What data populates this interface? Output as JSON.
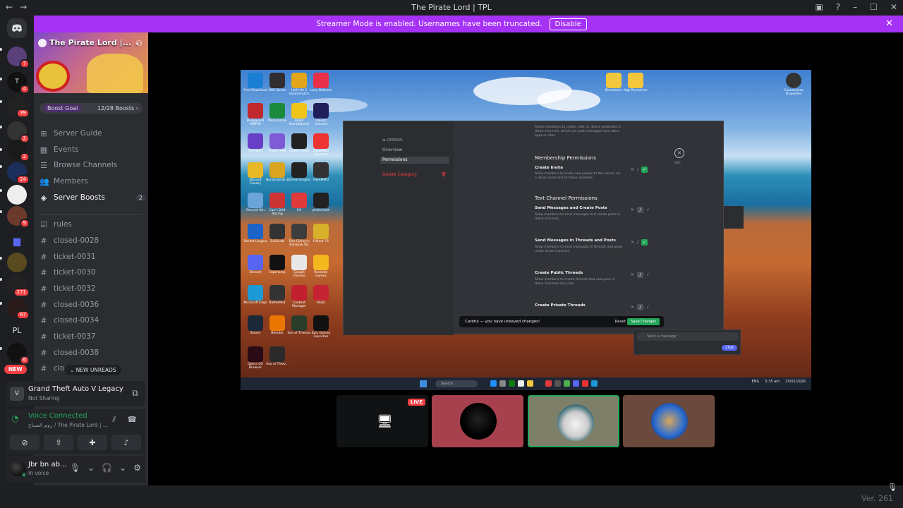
{
  "window": {
    "title": "The Pirate Lord | TPL",
    "back_glyph": "←",
    "forward_glyph": "→",
    "controls": [
      "▣",
      "?",
      "–",
      "☐",
      "✕"
    ]
  },
  "streamer_banner": {
    "text": "Streamer Mode is enabled. Usernames have been truncated.",
    "button": "Disable",
    "close": "✕"
  },
  "guild_rail": {
    "items": [
      {
        "label": "",
        "badge": "7"
      },
      {
        "label": "T",
        "badge": "4"
      },
      {
        "label": "",
        "badge": "39"
      },
      {
        "label": "",
        "badge": "2"
      },
      {
        "label": "",
        "badge": "2"
      },
      {
        "label": "",
        "badge": "24"
      },
      {
        "label": "",
        "badge": ""
      },
      {
        "label": "",
        "badge": "9"
      },
      {
        "label": "",
        "badge": ""
      },
      {
        "label": "",
        "badge": ""
      },
      {
        "label": "",
        "badge": "271"
      },
      {
        "label": "",
        "badge": "67"
      },
      {
        "label": "PL",
        "badge": ""
      },
      {
        "label": "",
        "badge": "6"
      }
    ],
    "new_badge": "NEW"
  },
  "server": {
    "name": "The Pirate Lord |...",
    "boost_goal": "Boost Goal",
    "boost_count": "12/28 Boosts",
    "boost_chevron": "›",
    "nav": [
      {
        "label": "Server Guide",
        "icon": "⊞"
      },
      {
        "label": "Events",
        "icon": "▦"
      },
      {
        "label": "Browse Channels",
        "icon": "☰"
      },
      {
        "label": "Members",
        "icon": "👥"
      },
      {
        "label": "Server Boosts",
        "icon": "◈",
        "count": "2"
      }
    ],
    "channels": [
      "rules",
      "closed-0028",
      "ticket-0031",
      "ticket-0030",
      "ticket-0032",
      "closed-0036",
      "closed-0034",
      "ticket-0037",
      "closed-0038",
      "clo"
    ],
    "new_unreads": "NEW UNREADS"
  },
  "activity": {
    "game": "Grand Theft Auto V Legacy",
    "status": "Not Sharing"
  },
  "voice": {
    "status": "Voice Connected",
    "channel": "روم الصباح / The Pirate Lord | ..."
  },
  "user": {
    "name": "Jbr bn ab...",
    "status": "In voice"
  },
  "stream": {
    "desktop_icons": [
      {
        "label": "Free Download",
        "color": "#1a7fd4"
      },
      {
        "label": "OBS Studio",
        "color": "#302e31"
      },
      {
        "label": "Half-Life 2 Deathmatch",
        "color": "#e3a61b"
      },
      {
        "label": "Lucy Network",
        "color": "#e8304a"
      },
      {
        "label": "Bodyguard MMPOI",
        "color": "#c0282d"
      },
      {
        "label": "MusicGame",
        "color": "#1b8a3d"
      },
      {
        "label": "Finish Need4Speed",
        "color": "#f0c419"
      },
      {
        "label": "Ubisoft Connect",
        "color": "#1f1f5c"
      },
      {
        "label": "Overwolf",
        "color": "#6a3fc8"
      },
      {
        "label": "Proton VPN",
        "color": "#7f5bd5"
      },
      {
        "label": "Rebox Client",
        "color": "#222"
      },
      {
        "label": "PokeMMO Launcher",
        "color": "#e33"
      },
      {
        "label": "Discord Canary",
        "color": "#e9b825"
      },
      {
        "label": "Borderlands 2",
        "color": "#d9a521"
      },
      {
        "label": "Unreal Engine",
        "color": "#222"
      },
      {
        "label": "PokeMMO",
        "color": "#333"
      },
      {
        "label": "Recycle Bin",
        "color": "#6aa4d8"
      },
      {
        "label": "Can't Drift Racing",
        "color": "#c33"
      },
      {
        "label": "EA",
        "color": "#e03a3a"
      },
      {
        "label": "photomath",
        "color": "#222"
      },
      {
        "label": "Rocket League",
        "color": "#1b63c9"
      },
      {
        "label": "EaSeLab",
        "color": "#333"
      },
      {
        "label": "Tom Clancy's Rainbow Six",
        "color": "#3d3d3d"
      },
      {
        "label": "Fallout 76",
        "color": "#d7b02a"
      },
      {
        "label": "Discord",
        "color": "#5865f2"
      },
      {
        "label": "Clipchamp",
        "color": "#111"
      },
      {
        "label": "Google Chrome",
        "color": "#e8e8e8"
      },
      {
        "label": "Rockstar Games",
        "color": "#f3b81e"
      },
      {
        "label": "Microsoft Edge",
        "color": "#1c9ad6"
      },
      {
        "label": "BattleMod",
        "color": "#333"
      },
      {
        "label": "Content Manager",
        "color": "#c21f2f"
      },
      {
        "label": "RAGE",
        "color": "#c52234"
      },
      {
        "label": "Steam",
        "color": "#1b2838"
      },
      {
        "label": "Blender",
        "color": "#ea7600"
      },
      {
        "label": "Sea of Thieves",
        "color": "#2a3d2a"
      },
      {
        "label": "Epic Games Launcher",
        "color": "#111"
      },
      {
        "label": "Opera GX Browser",
        "color": "#2a0a14"
      },
      {
        "label": "Sea of Thiev...",
        "color": "#2a2a2a"
      }
    ],
    "top_right_icons": [
      {
        "label": "Bluestacks",
        "color": "#f2c73c"
      },
      {
        "label": "App Resources",
        "color": "#f2c73c"
      },
      {
        "label": "Connections Properties",
        "color": "#333"
      }
    ],
    "settings": {
      "category": "GENERAL",
      "sidebar": [
        "Overview",
        "Permissions"
      ],
      "delete": "Delete Category",
      "top_desc": "Allows members to create, edit, or delete webhooks in these channels, which can post messages from other apps or sites.",
      "membership_heading": "Membership Permissions",
      "text_heading": "Text Channel Permissions",
      "perms": [
        {
          "title": "Create Invite",
          "desc": "Allow members to invite new people to this server via a direct invite link to these channels.",
          "state": "on"
        },
        {
          "title": "Send Messages and Create Posts",
          "desc": "Allow members to send messages and create posts in these channels.",
          "state": "neutral"
        },
        {
          "title": "Send Messages in Threads and Posts",
          "desc": "Allow members to send messages in threads and posts under these channels.",
          "state": "on"
        },
        {
          "title": "Create Public Threads",
          "desc": "Allow members to create threads that everyone in these channels can view.",
          "state": "neutral"
        },
        {
          "title": "Create Private Threads",
          "desc": "Allow members to create invite-only threads.",
          "state": "neutral"
        }
      ],
      "esc": "ESC",
      "unsaved": "Careful — you have unsaved changes!",
      "reset": "Reset",
      "save": "Save Changes"
    },
    "chat_input": "Send a message",
    "chat_button": "Chat",
    "taskbar": {
      "search": "Search",
      "tray": [
        "ENG",
        "5:35 am",
        "25/02/2026"
      ]
    }
  },
  "tiles": {
    "live": "LIVE"
  },
  "version": "Ver. 261"
}
